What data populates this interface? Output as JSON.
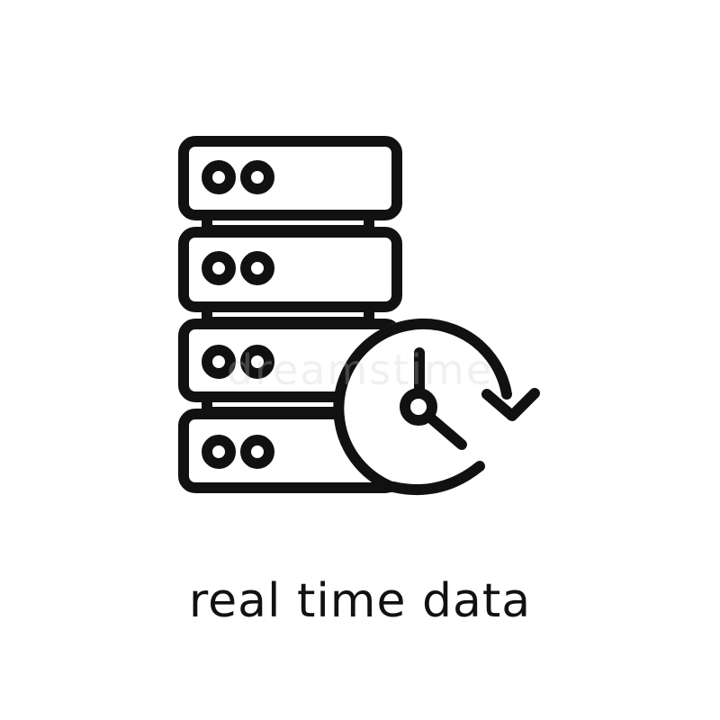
{
  "caption": "real time data",
  "watermark": "dreamstime",
  "icon": {
    "name": "server-clock-icon",
    "stroke_color": "#111111",
    "background": "#ffffff"
  }
}
